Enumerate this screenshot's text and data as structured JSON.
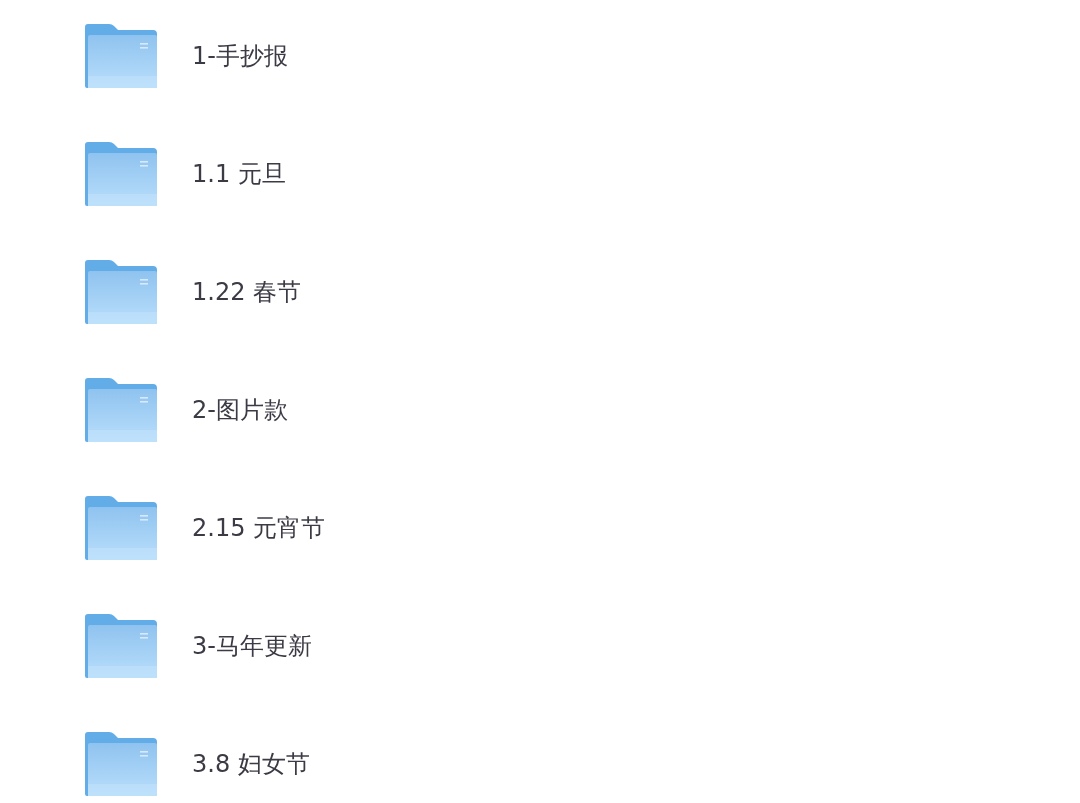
{
  "folders": [
    {
      "name": "1-手抄报"
    },
    {
      "name": "1.1 元旦"
    },
    {
      "name": "1.22 春节"
    },
    {
      "name": "2-图片款"
    },
    {
      "name": "2.15 元宵节"
    },
    {
      "name": "3-马年更新"
    },
    {
      "name": "3.8 妇女节"
    }
  ]
}
